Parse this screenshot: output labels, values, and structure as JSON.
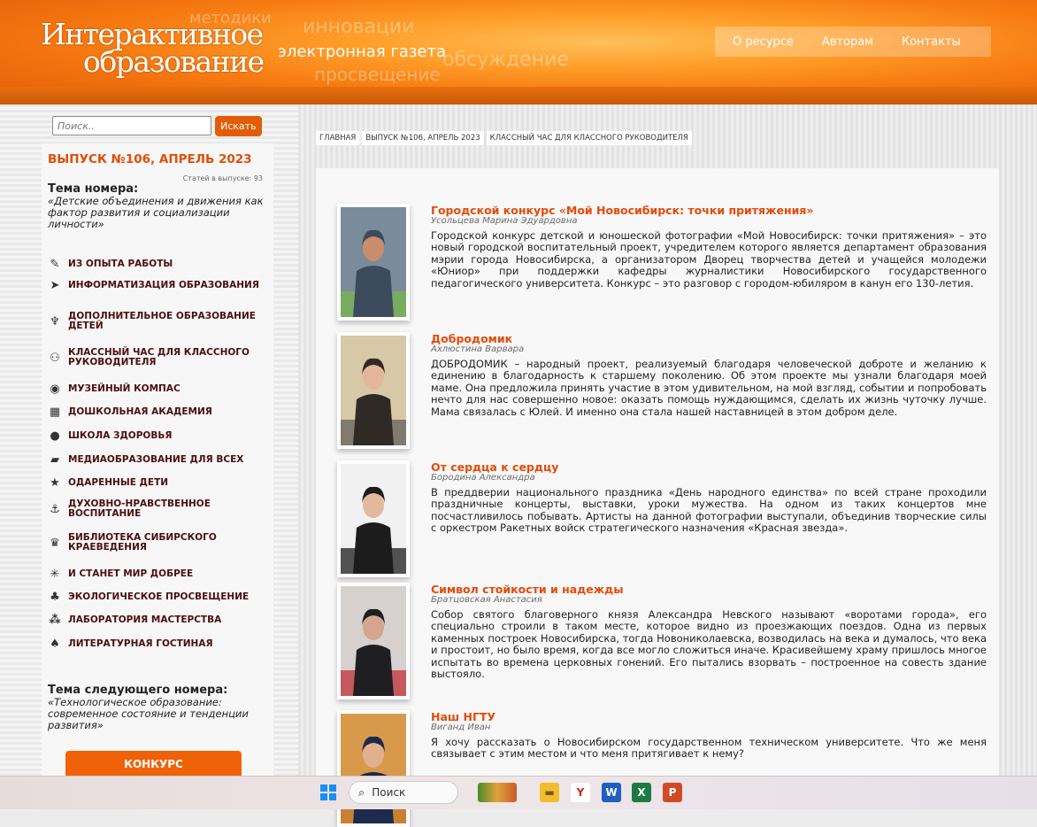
{
  "header": {
    "logo_line1": "Интерактивное",
    "logo_line2": "образование",
    "tagline": "электронная газета",
    "ghost_words": [
      "методики",
      "инновации",
      "обсуждение",
      "просвещение"
    ],
    "nav": [
      "О ресурсе",
      "Авторам",
      "Контакты"
    ]
  },
  "search": {
    "placeholder": "Поиск..",
    "button": "Искать"
  },
  "issue": {
    "title": "ВЫПУСК №106, АПРЕЛЬ 2023",
    "count": "Статей в выпуске: 93",
    "topic_label": "Тема номера:",
    "topic_text": "«Детские объединения и движения как фактор развития и социализации личности»",
    "next_label": "Тема следующего номера:",
    "next_text": "«Технологическое образование: современное состояние и тенденции развития»",
    "contest_button": "КОНКУРС"
  },
  "categories": [
    {
      "label": "ИЗ ОПЫТА РАБОТЫ",
      "icon": "pen-icon"
    },
    {
      "label": "ИНФОРМАТИЗАЦИЯ ОБРАЗОВАНИЯ",
      "icon": "cursor-icon"
    },
    {
      "label": "ДОПОЛНИТЕЛЬНОЕ ОБРАЗОВАНИЕ ДЕТЕЙ",
      "icon": "trophy-icon"
    },
    {
      "label": "КЛАССНЫЙ ЧАС ДЛЯ КЛАССНОГО РУКОВОДИТЕЛЯ",
      "icon": "people-icon"
    },
    {
      "label": "МУЗЕЙНЫЙ КОМПАС",
      "icon": "compass-icon"
    },
    {
      "label": "ДОШКОЛЬНАЯ АКАДЕМИЯ",
      "icon": "blocks-icon"
    },
    {
      "label": "ШКОЛА ЗДОРОВЬЯ",
      "icon": "apple-icon"
    },
    {
      "label": "МЕДИАОБРАЗОВАНИЕ ДЛЯ ВСЕХ",
      "icon": "camera-icon"
    },
    {
      "label": "ОДАРЕННЫЕ ДЕТИ",
      "icon": "star-icon"
    },
    {
      "label": "ДУХОВНО-НРАВСТВЕННОЕ ВОСПИТАНИЕ",
      "icon": "anchor-icon"
    },
    {
      "label": "БИБЛИОТЕКА СИБИРСКОГО КРАЕВЕДЕНИЯ",
      "icon": "emblem-icon"
    },
    {
      "label": "И СТАНЕТ МИР ДОБРЕЕ",
      "icon": "snowflake-icon"
    },
    {
      "label": "ЭКОЛОГИЧЕСКОЕ ПРОСВЕЩЕНИЕ",
      "icon": "plant-icon"
    },
    {
      "label": "ЛАБОРАТОРИЯ МАСТЕРСТВА",
      "icon": "sparkle-icon"
    },
    {
      "label": "ЛИТЕРАТУРНАЯ ГОСТИНАЯ",
      "icon": "lamp-icon"
    }
  ],
  "breadcrumbs": [
    "ГЛАВНАЯ",
    "ВЫПУСК №106, АПРЕЛЬ 2023",
    "КЛАССНЫЙ ЧАС ДЛЯ КЛАССНОГО РУКОВОДИТЕЛЯ"
  ],
  "articles": [
    {
      "title": "Городской конкурс «Мой Новосибирск: точки притяжения»",
      "author": "Усольцева Марина Эдуардовна",
      "text": "Городской конкурс детской и юношеской фотографии «Мой Новосибирск: точки притяжения» – это новый городской воспитательный проект, учредителем которого является департамент образования мэрии города Новосибирска, а организатором Дворец творчества детей и учащейся молодежи «Юниор» при поддержки кафедры журналистики Новосибирского государственного педагогического университета. Конкурс – это разговор с городом-юбиляром в канун его 130-летия.",
      "photo": [
        "#7a8c9c",
        "#3b4a5c",
        "#c98d6c",
        "#79b352"
      ]
    },
    {
      "title": "Добродомик",
      "author": "Ахлюстина Варвара",
      "text": "ДОБРОДОМИК – народный проект, реализуемый благодаря человеческой доброте и желанию к единению в благодарность к старшему поколению. Об этом проекте мы узнали благодаря моей маме. Она предложила принять участие в этом удивительном, на мой взгляд, событии и попробовать нечто для нас совершенно новое: оказать помощь нуждающимся, сделать их жизнь чуточку лучше. Мама связалась с Юлей. И именно она стала нашей наставницей в этом добром деле.",
      "photo": [
        "#d7c8a8",
        "#2f2a26",
        "#e3b79c",
        "#6c6760"
      ]
    },
    {
      "title": "От сердца к сердцу",
      "author": "Бородина Александра",
      "text": "В преддверии национального праздника «День народного единства» по всей стране проходили праздничные концерты, выставки, уроки мужества. На одном из таких концертов мне посчастливилось побывать. Артисты на данной фотографии выступали, объединив творческие силы с оркестром Ракетных войск стратегического назначения «Красная звезда».",
      "photo": [
        "#f1f1f1",
        "#1c1c1c",
        "#e2b99c",
        "#2a2a2a"
      ]
    },
    {
      "title": "Символ стойкости и надежды",
      "author": "Братцовская Анастасия",
      "text": "Собор святого благоверного князя Александра Невского называют «воротами города», его специально строили в таком месте, которое видно из проезжающих поездов. Одна из первых каменных построек Новосибирска, тогда Новониколаевска, возводилась на века и думалось, что века и простоит, но было время, когда все могло сложиться иначе. Красивейшему храму пришлось многое испытать во времена церковных гонений. Его пытались взорвать – построенное на совесть здание выстояло.",
      "photo": [
        "#d6d0cf",
        "#1f1f22",
        "#d5a58e",
        "#c23a44"
      ]
    },
    {
      "title": "Наш НГТУ",
      "author": "Виганд Иван",
      "text": "Я хочу рассказать о Новосибирском государственном техническом университете. Что же меня связывает с этим местом и что меня притягивает к нему?",
      "photo": [
        "#d89a4a",
        "#1e2a4c",
        "#e0b08f",
        "#c67a2e"
      ]
    }
  ],
  "taskbar": {
    "search_label": "Поиск"
  },
  "colors": {
    "accent": "#e84a07",
    "category": "#4b0f0f",
    "header": "#f77b12"
  }
}
